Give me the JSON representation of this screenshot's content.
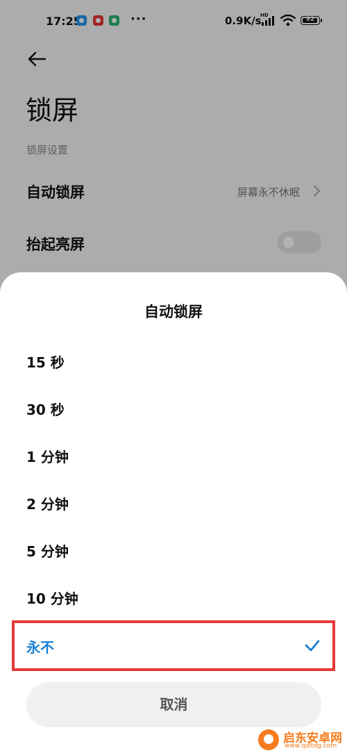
{
  "status_bar": {
    "time": "17:25",
    "more": "···",
    "network_speed": "0.9K/s",
    "hd_badge": "HD",
    "battery": "92",
    "app_icons": [
      "#2196f3",
      "#e53935",
      "#2bb673"
    ]
  },
  "header": {
    "back_icon": "arrow-left-icon",
    "title": "锁屏"
  },
  "settings": {
    "section_header": "锁屏设置",
    "auto_lock": {
      "label": "自动锁屏",
      "value": "屏幕永不休眠"
    },
    "raise_to_wake": {
      "label": "抬起亮屏",
      "enabled": false
    }
  },
  "dialog": {
    "title": "自动锁屏",
    "options": [
      {
        "label": "15 秒"
      },
      {
        "label": "30 秒"
      },
      {
        "label": "1 分钟"
      },
      {
        "label": "2 分钟"
      },
      {
        "label": "5 分钟"
      },
      {
        "label": "10 分钟"
      },
      {
        "label": "永不",
        "selected": true
      }
    ],
    "cancel_label": "取消"
  },
  "watermark": {
    "name": "启东安卓网",
    "url": "www.qdltdg.com"
  },
  "colors": {
    "accent": "#1a7fd6",
    "highlight": "#e53935",
    "watermark": "#f57c1f"
  }
}
